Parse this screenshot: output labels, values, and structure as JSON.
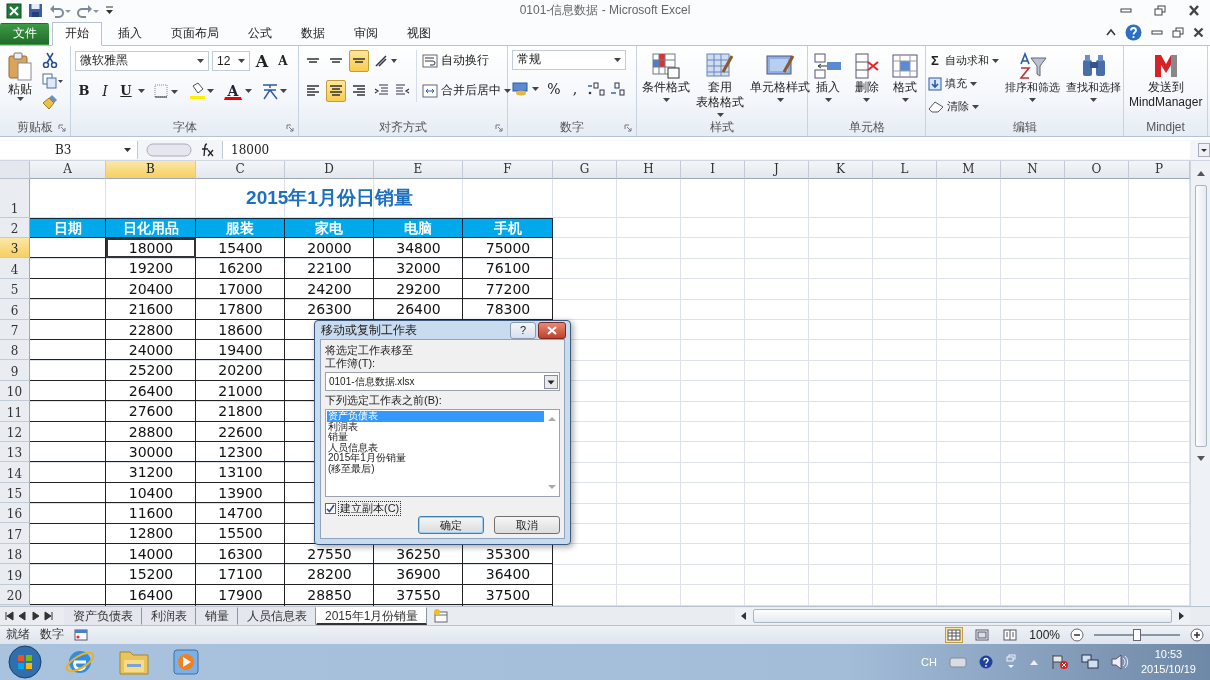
{
  "title_bar": {
    "title": "0101-信息数据 - Microsoft Excel"
  },
  "tabs": [
    {
      "label": "文件",
      "selected": false,
      "kind": "file"
    },
    {
      "label": "开始",
      "selected": true,
      "kind": "tab"
    },
    {
      "label": "插入",
      "selected": false,
      "kind": "tab"
    },
    {
      "label": "页面布局",
      "selected": false,
      "kind": "tab"
    },
    {
      "label": "公式",
      "selected": false,
      "kind": "tab"
    },
    {
      "label": "数据",
      "selected": false,
      "kind": "tab"
    },
    {
      "label": "审阅",
      "selected": false,
      "kind": "tab"
    },
    {
      "label": "视图",
      "selected": false,
      "kind": "tab"
    }
  ],
  "ribbon": {
    "clipboard": {
      "label": "剪贴板",
      "paste": "粘贴"
    },
    "font": {
      "label": "字体",
      "font_name": "微软雅黑",
      "font_size": "12",
      "grow": "A",
      "shrink": "A",
      "bold": "B",
      "italic": "I",
      "underline": "U",
      "font_color": "A"
    },
    "alignment": {
      "label": "对齐方式",
      "vertical": [
        {
          "selected": false
        },
        {
          "selected": false
        },
        {
          "selected": true
        }
      ],
      "horizontal": [
        {
          "selected": false
        },
        {
          "selected": true
        },
        {
          "selected": false
        }
      ],
      "wrap": "自动换行",
      "merge": "合并后居中"
    },
    "number": {
      "label": "数字",
      "format": "常规",
      "percent": "%",
      "comma": ","
    },
    "styles": {
      "label": "样式",
      "items": [
        {
          "lines": [
            "条件格式"
          ]
        },
        {
          "lines": [
            "套用",
            "表格格式"
          ]
        },
        {
          "lines": [
            "单元格样式"
          ]
        }
      ]
    },
    "cells": {
      "label": "单元格",
      "items": [
        "插入",
        "删除",
        "格式"
      ]
    },
    "editing": {
      "label": "编辑",
      "sum_glyph": "Σ",
      "autosum": "自动求和",
      "fill": "填充",
      "clear": "清除",
      "sort": "排序和筛选",
      "find": "查找和选择"
    },
    "mindjet": {
      "label": "Mindjet",
      "send": [
        "发送到",
        "MindManager"
      ]
    }
  },
  "formula_bar": {
    "name_box": "B3",
    "value": "18000"
  },
  "sheet": {
    "columns": [
      {
        "label": "A",
        "selected": false
      },
      {
        "label": "B",
        "selected": true
      },
      {
        "label": "C",
        "selected": false
      },
      {
        "label": "D",
        "selected": false
      },
      {
        "label": "E",
        "selected": false
      },
      {
        "label": "F",
        "selected": false
      },
      {
        "label": "G",
        "selected": false
      },
      {
        "label": "H",
        "selected": false
      },
      {
        "label": "I",
        "selected": false
      },
      {
        "label": "J",
        "selected": false
      },
      {
        "label": "K",
        "selected": false
      },
      {
        "label": "L",
        "selected": false
      },
      {
        "label": "M",
        "selected": false
      },
      {
        "label": "N",
        "selected": false
      },
      {
        "label": "O",
        "selected": false
      },
      {
        "label": "P",
        "selected": false
      }
    ],
    "rows": [
      {
        "number": "1",
        "selected": false,
        "kind": "title",
        "title": "2015年1月份日销量"
      },
      {
        "number": "2",
        "selected": false,
        "kind": "header",
        "cells": [
          "日期",
          "日化用品",
          "服装",
          "家电",
          "电脑",
          "手机"
        ]
      },
      {
        "number": "3",
        "selected": true,
        "kind": "data",
        "values": [
          "18000",
          "15400",
          "20000",
          "34800",
          "75000"
        ]
      },
      {
        "number": "4",
        "selected": false,
        "kind": "data",
        "values": [
          "19200",
          "16200",
          "22100",
          "32000",
          "76100"
        ]
      },
      {
        "number": "5",
        "selected": false,
        "kind": "data",
        "values": [
          "20400",
          "17000",
          "24200",
          "29200",
          "77200"
        ]
      },
      {
        "number": "6",
        "selected": false,
        "kind": "data",
        "values": [
          "21600",
          "17800",
          "26300",
          "26400",
          "78300"
        ]
      },
      {
        "number": "7",
        "selected": false,
        "kind": "data",
        "values": [
          "22800",
          "18600"
        ]
      },
      {
        "number": "8",
        "selected": false,
        "kind": "data",
        "values": [
          "24000",
          "19400"
        ]
      },
      {
        "number": "9",
        "selected": false,
        "kind": "data",
        "values": [
          "25200",
          "20200"
        ]
      },
      {
        "number": "10",
        "selected": false,
        "kind": "data",
        "values": [
          "26400",
          "21000"
        ]
      },
      {
        "number": "11",
        "selected": false,
        "kind": "data",
        "values": [
          "27600",
          "21800"
        ]
      },
      {
        "number": "12",
        "selected": false,
        "kind": "data",
        "values": [
          "28800",
          "22600"
        ]
      },
      {
        "number": "13",
        "selected": false,
        "kind": "data",
        "values": [
          "30000",
          "12300"
        ]
      },
      {
        "number": "14",
        "selected": false,
        "kind": "data",
        "values": [
          "31200",
          "13100"
        ]
      },
      {
        "number": "15",
        "selected": false,
        "kind": "data",
        "values": [
          "10400",
          "13900"
        ]
      },
      {
        "number": "16",
        "selected": false,
        "kind": "data",
        "values": [
          "11600",
          "14700"
        ]
      },
      {
        "number": "17",
        "selected": false,
        "kind": "data",
        "values": [
          "12800",
          "15500"
        ]
      },
      {
        "number": "18",
        "selected": false,
        "kind": "data",
        "values": [
          "14000",
          "16300",
          "27550",
          "36250",
          "35300"
        ]
      },
      {
        "number": "19",
        "selected": false,
        "kind": "data",
        "values": [
          "15200",
          "17100",
          "28200",
          "36900",
          "36400"
        ]
      },
      {
        "number": "20",
        "selected": false,
        "kind": "data",
        "values": [
          "16400",
          "17900",
          "28850",
          "37550",
          "37500"
        ]
      }
    ]
  },
  "sheet_tabs": [
    {
      "label": "资产负债表",
      "selected": false
    },
    {
      "label": "利润表",
      "selected": false
    },
    {
      "label": "销量",
      "selected": false
    },
    {
      "label": "人员信息表",
      "selected": false
    },
    {
      "label": "2015年1月份销量",
      "selected": true
    }
  ],
  "status_bar": {
    "ready": "就绪",
    "mode": "数字",
    "views": [
      {
        "selected": true
      },
      {
        "selected": false
      },
      {
        "selected": false
      }
    ],
    "zoom": "100%",
    "zoom_slider": {
      "level": 0.5
    }
  },
  "dialog": {
    "title": "移动或复制工作表",
    "help": "?",
    "move_to": "将选定工作表移至",
    "workbook_label": "工作簿(T):",
    "workbook": "0101-信息数据.xlsx",
    "before_label": "下列选定工作表之前(B):",
    "sheets": [
      {
        "label": "资产负债表",
        "selected": true
      },
      {
        "label": "利润表",
        "selected": false
      },
      {
        "label": "销量",
        "selected": false
      },
      {
        "label": "人员信息表",
        "selected": false
      },
      {
        "label": "2015年1月份销量",
        "selected": false
      },
      {
        "label": "(移至最后)",
        "selected": false
      }
    ],
    "copy": {
      "label": "建立副本(C)",
      "checked": true
    },
    "ok": "确定",
    "cancel": "取消"
  },
  "taskbar": {
    "language": "CH",
    "time": "10:53",
    "date": "2015/10/19"
  }
}
